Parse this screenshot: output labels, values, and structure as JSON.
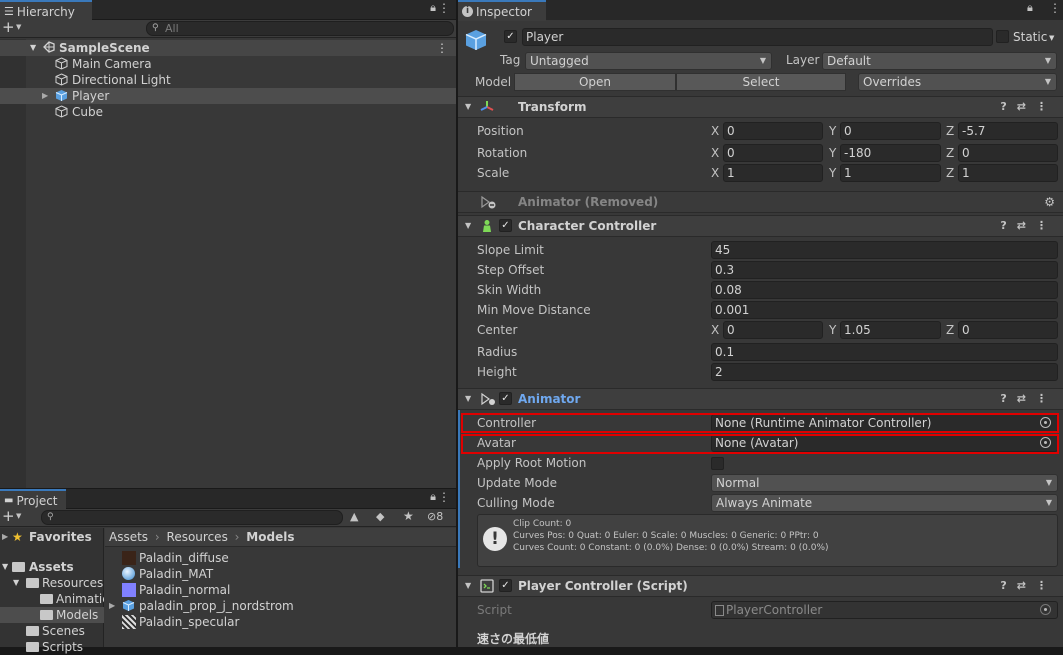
{
  "hierarchy": {
    "tab": "Hierarchy",
    "search_placeholder": "All",
    "scene": "SampleScene",
    "items": [
      "Main Camera",
      "Directional Light",
      "Player",
      "Cube"
    ]
  },
  "project": {
    "tab": "Project",
    "favorites": "Favorites",
    "assets": "Assets",
    "tree": [
      "Resources",
      "Animatic",
      "Models",
      "Scenes",
      "Scripts"
    ],
    "badge": "8",
    "breadcrumb": [
      "Assets",
      "Resources",
      "Models"
    ],
    "files": [
      "Paladin_diffuse",
      "Paladin_MAT",
      "Paladin_normal",
      "paladin_prop_j_nordstrom",
      "Paladin_specular"
    ]
  },
  "inspector": {
    "tab": "Inspector",
    "name": "Player",
    "static": "Static",
    "tag_label": "Tag",
    "tag": "Untagged",
    "layer_label": "Layer",
    "layer": "Default",
    "model_label": "Model",
    "open": "Open",
    "select": "Select",
    "overrides": "Overrides",
    "transform": {
      "title": "Transform",
      "position_label": "Position",
      "rotation_label": "Rotation",
      "scale_label": "Scale",
      "axes": [
        "X",
        "Y",
        "Z"
      ],
      "position": [
        "0",
        "0",
        "-5.7"
      ],
      "rotation": [
        "0",
        "-180",
        "0"
      ],
      "scale": [
        "1",
        "1",
        "1"
      ]
    },
    "animator_removed": "Animator (Removed)",
    "cc": {
      "title": "Character Controller",
      "labels": [
        "Slope Limit",
        "Step Offset",
        "Skin Width",
        "Min Move Distance",
        "Center",
        "Radius",
        "Height"
      ],
      "slope": "45",
      "step": "0.3",
      "skin": "0.08",
      "minmove": "0.001",
      "center": [
        "0",
        "1.05",
        "0"
      ],
      "radius": "0.1",
      "height": "2"
    },
    "animator": {
      "title": "Animator",
      "controller_label": "Controller",
      "controller": "None (Runtime Animator Controller)",
      "avatar_label": "Avatar",
      "avatar": "None (Avatar)",
      "root_label": "Apply Root Motion",
      "update_label": "Update Mode",
      "update": "Normal",
      "culling_label": "Culling Mode",
      "culling": "Always Animate",
      "info": [
        "Clip Count: 0",
        "Curves Pos: 0 Quat: 0 Euler: 0 Scale: 0 Muscles: 0 Generic: 0 PPtr: 0",
        "Curves Count: 0 Constant: 0 (0.0%) Dense: 0 (0.0%) Stream: 0 (0.0%)"
      ]
    },
    "pc": {
      "title": "Player Controller (Script)",
      "script_label": "Script",
      "script": "PlayerController",
      "section": "速さの最低値"
    }
  }
}
